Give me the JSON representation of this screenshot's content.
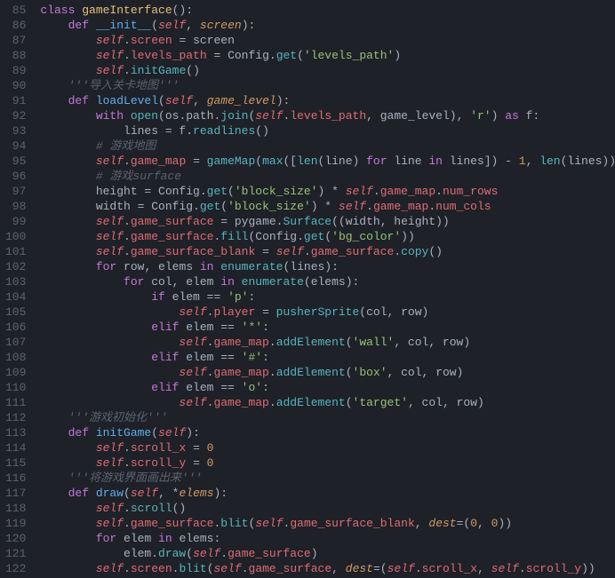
{
  "line_start": 85,
  "line_end": 122,
  "lines": {
    "85": [
      [
        "kw",
        "class "
      ],
      [
        "cls",
        "gameInterface"
      ],
      [
        "punc",
        "():"
      ]
    ],
    "86": [
      [
        "kw",
        "    def "
      ],
      [
        "def",
        "__init__"
      ],
      [
        "punc",
        "("
      ],
      [
        "self",
        "self"
      ],
      [
        "punc",
        ", "
      ],
      [
        "param",
        "screen"
      ],
      [
        "punc",
        "):"
      ]
    ],
    "87": [
      [
        "self",
        "        self"
      ],
      [
        "punc",
        "."
      ],
      [
        "prop",
        "screen"
      ],
      [
        "op",
        " = "
      ],
      [
        "op",
        "screen"
      ]
    ],
    "88": [
      [
        "self",
        "        self"
      ],
      [
        "punc",
        "."
      ],
      [
        "prop",
        "levels_path"
      ],
      [
        "op",
        " = "
      ],
      [
        "op",
        "Config."
      ],
      [
        "fn",
        "get"
      ],
      [
        "punc",
        "("
      ],
      [
        "str",
        "'levels_path'"
      ],
      [
        "punc",
        ")"
      ]
    ],
    "89": [
      [
        "self",
        "        self"
      ],
      [
        "punc",
        "."
      ],
      [
        "fn",
        "initGame"
      ],
      [
        "punc",
        "()"
      ]
    ],
    "90": [
      [
        "cmt",
        "    '''导入关卡地图'''"
      ]
    ],
    "91": [
      [
        "kw",
        "    def "
      ],
      [
        "def",
        "loadLevel"
      ],
      [
        "punc",
        "("
      ],
      [
        "self",
        "self"
      ],
      [
        "punc",
        ", "
      ],
      [
        "param",
        "game_level"
      ],
      [
        "punc",
        "):"
      ]
    ],
    "92": [
      [
        "kw",
        "        with "
      ],
      [
        "builtin",
        "open"
      ],
      [
        "punc",
        "(os.path."
      ],
      [
        "fn",
        "join"
      ],
      [
        "punc",
        "("
      ],
      [
        "self",
        "self"
      ],
      [
        "punc",
        "."
      ],
      [
        "prop",
        "levels_path"
      ],
      [
        "punc",
        ", game_level), "
      ],
      [
        "str",
        "'r'"
      ],
      [
        "punc",
        ") "
      ],
      [
        "kw",
        "as"
      ],
      [
        "punc",
        " f:"
      ]
    ],
    "93": [
      [
        "op",
        "            lines = f."
      ],
      [
        "fn",
        "readlines"
      ],
      [
        "punc",
        "()"
      ]
    ],
    "94": [
      [
        "cmt",
        "        # 游戏地图"
      ]
    ],
    "95": [
      [
        "self",
        "        self"
      ],
      [
        "punc",
        "."
      ],
      [
        "prop",
        "game_map"
      ],
      [
        "op",
        " = "
      ],
      [
        "fn",
        "gameMap"
      ],
      [
        "punc",
        "("
      ],
      [
        "builtin",
        "max"
      ],
      [
        "punc",
        "(["
      ],
      [
        "builtin",
        "len"
      ],
      [
        "punc",
        "(line) "
      ],
      [
        "kw",
        "for"
      ],
      [
        "punc",
        " line "
      ],
      [
        "kw",
        "in"
      ],
      [
        "punc",
        " lines]) - "
      ],
      [
        "num",
        "1"
      ],
      [
        "punc",
        ", "
      ],
      [
        "builtin",
        "len"
      ],
      [
        "punc",
        "(lines))"
      ]
    ],
    "96": [
      [
        "cmt",
        "        # 游戏surface"
      ]
    ],
    "97": [
      [
        "op",
        "        height = Config."
      ],
      [
        "fn",
        "get"
      ],
      [
        "punc",
        "("
      ],
      [
        "str",
        "'block_size'"
      ],
      [
        "punc",
        ") * "
      ],
      [
        "self",
        "self"
      ],
      [
        "punc",
        "."
      ],
      [
        "prop",
        "game_map"
      ],
      [
        "punc",
        "."
      ],
      [
        "prop",
        "num_rows"
      ]
    ],
    "98": [
      [
        "op",
        "        width = Config."
      ],
      [
        "fn",
        "get"
      ],
      [
        "punc",
        "("
      ],
      [
        "str",
        "'block_size'"
      ],
      [
        "punc",
        ") * "
      ],
      [
        "self",
        "self"
      ],
      [
        "punc",
        "."
      ],
      [
        "prop",
        "game_map"
      ],
      [
        "punc",
        "."
      ],
      [
        "prop",
        "num_cols"
      ]
    ],
    "99": [
      [
        "self",
        "        self"
      ],
      [
        "punc",
        "."
      ],
      [
        "prop",
        "game_surface"
      ],
      [
        "op",
        " = pygame."
      ],
      [
        "fn",
        "Surface"
      ],
      [
        "punc",
        "((width, height))"
      ]
    ],
    "100": [
      [
        "self",
        "        self"
      ],
      [
        "punc",
        "."
      ],
      [
        "prop",
        "game_surface"
      ],
      [
        "punc",
        "."
      ],
      [
        "fn",
        "fill"
      ],
      [
        "punc",
        "(Config."
      ],
      [
        "fn",
        "get"
      ],
      [
        "punc",
        "("
      ],
      [
        "str",
        "'bg_color'"
      ],
      [
        "punc",
        "))"
      ]
    ],
    "101": [
      [
        "self",
        "        self"
      ],
      [
        "punc",
        "."
      ],
      [
        "prop",
        "game_surface_blank"
      ],
      [
        "op",
        " = "
      ],
      [
        "self",
        "self"
      ],
      [
        "punc",
        "."
      ],
      [
        "prop",
        "game_surface"
      ],
      [
        "punc",
        "."
      ],
      [
        "fn",
        "copy"
      ],
      [
        "punc",
        "()"
      ]
    ],
    "102": [
      [
        "kw",
        "        for"
      ],
      [
        "op",
        " row, elems "
      ],
      [
        "kw",
        "in "
      ],
      [
        "builtin",
        "enumerate"
      ],
      [
        "punc",
        "(lines):"
      ]
    ],
    "103": [
      [
        "kw",
        "            for"
      ],
      [
        "op",
        " col, elem "
      ],
      [
        "kw",
        "in "
      ],
      [
        "builtin",
        "enumerate"
      ],
      [
        "punc",
        "(elems):"
      ]
    ],
    "104": [
      [
        "kw",
        "                if"
      ],
      [
        "op",
        " elem == "
      ],
      [
        "str",
        "'p'"
      ],
      [
        "punc",
        ":"
      ]
    ],
    "105": [
      [
        "self",
        "                    self"
      ],
      [
        "punc",
        "."
      ],
      [
        "prop",
        "player"
      ],
      [
        "op",
        " = "
      ],
      [
        "fn",
        "pusherSprite"
      ],
      [
        "punc",
        "(col, row)"
      ]
    ],
    "106": [
      [
        "kw",
        "                elif"
      ],
      [
        "op",
        " elem == "
      ],
      [
        "str",
        "'*'"
      ],
      [
        "punc",
        ":"
      ]
    ],
    "107": [
      [
        "self",
        "                    self"
      ],
      [
        "punc",
        "."
      ],
      [
        "prop",
        "game_map"
      ],
      [
        "punc",
        "."
      ],
      [
        "fn",
        "addElement"
      ],
      [
        "punc",
        "("
      ],
      [
        "str",
        "'wall'"
      ],
      [
        "punc",
        ", col, row)"
      ]
    ],
    "108": [
      [
        "kw",
        "                elif"
      ],
      [
        "op",
        " elem == "
      ],
      [
        "str",
        "'#'"
      ],
      [
        "punc",
        ":"
      ]
    ],
    "109": [
      [
        "self",
        "                    self"
      ],
      [
        "punc",
        "."
      ],
      [
        "prop",
        "game_map"
      ],
      [
        "punc",
        "."
      ],
      [
        "fn",
        "addElement"
      ],
      [
        "punc",
        "("
      ],
      [
        "str",
        "'box'"
      ],
      [
        "punc",
        ", col, row)"
      ]
    ],
    "110": [
      [
        "kw",
        "                elif"
      ],
      [
        "op",
        " elem == "
      ],
      [
        "str",
        "'o'"
      ],
      [
        "punc",
        ":"
      ]
    ],
    "111": [
      [
        "self",
        "                    self"
      ],
      [
        "punc",
        "."
      ],
      [
        "prop",
        "game_map"
      ],
      [
        "punc",
        "."
      ],
      [
        "fn",
        "addElement"
      ],
      [
        "punc",
        "("
      ],
      [
        "str",
        "'target'"
      ],
      [
        "punc",
        ", col, row)"
      ]
    ],
    "112": [
      [
        "cmt",
        "    '''游戏初始化'''"
      ]
    ],
    "113": [
      [
        "kw",
        "    def "
      ],
      [
        "def",
        "initGame"
      ],
      [
        "punc",
        "("
      ],
      [
        "self",
        "self"
      ],
      [
        "punc",
        "):"
      ]
    ],
    "114": [
      [
        "self",
        "        self"
      ],
      [
        "punc",
        "."
      ],
      [
        "prop",
        "scroll_x"
      ],
      [
        "op",
        " = "
      ],
      [
        "num",
        "0"
      ]
    ],
    "115": [
      [
        "self",
        "        self"
      ],
      [
        "punc",
        "."
      ],
      [
        "prop",
        "scroll_y"
      ],
      [
        "op",
        " = "
      ],
      [
        "num",
        "0"
      ]
    ],
    "116": [
      [
        "cmt",
        "    '''将游戏界面画出来'''"
      ]
    ],
    "117": [
      [
        "kw",
        "    def "
      ],
      [
        "def",
        "draw"
      ],
      [
        "punc",
        "("
      ],
      [
        "self",
        "self"
      ],
      [
        "punc",
        ", *"
      ],
      [
        "param",
        "elems"
      ],
      [
        "punc",
        "):"
      ]
    ],
    "118": [
      [
        "self",
        "        self"
      ],
      [
        "punc",
        "."
      ],
      [
        "fn",
        "scroll"
      ],
      [
        "punc",
        "()"
      ]
    ],
    "119": [
      [
        "self",
        "        self"
      ],
      [
        "punc",
        "."
      ],
      [
        "prop",
        "game_surface"
      ],
      [
        "punc",
        "."
      ],
      [
        "fn",
        "blit"
      ],
      [
        "punc",
        "("
      ],
      [
        "self",
        "self"
      ],
      [
        "punc",
        "."
      ],
      [
        "prop",
        "game_surface_blank"
      ],
      [
        "punc",
        ", "
      ],
      [
        "param",
        "dest"
      ],
      [
        "op",
        "="
      ],
      [
        "punc",
        "("
      ],
      [
        "num",
        "0"
      ],
      [
        "punc",
        ", "
      ],
      [
        "num",
        "0"
      ],
      [
        "punc",
        "))"
      ]
    ],
    "120": [
      [
        "kw",
        "        for"
      ],
      [
        "op",
        " elem "
      ],
      [
        "kw",
        "in"
      ],
      [
        "op",
        " elems:"
      ]
    ],
    "121": [
      [
        "op",
        "            elem."
      ],
      [
        "fn",
        "draw"
      ],
      [
        "punc",
        "("
      ],
      [
        "self",
        "self"
      ],
      [
        "punc",
        "."
      ],
      [
        "prop",
        "game_surface"
      ],
      [
        "punc",
        ")"
      ]
    ],
    "122": [
      [
        "self",
        "        self"
      ],
      [
        "punc",
        "."
      ],
      [
        "prop",
        "screen"
      ],
      [
        "punc",
        "."
      ],
      [
        "fn",
        "blit"
      ],
      [
        "punc",
        "("
      ],
      [
        "self",
        "self"
      ],
      [
        "punc",
        "."
      ],
      [
        "prop",
        "game_surface"
      ],
      [
        "punc",
        ", "
      ],
      [
        "param",
        "dest"
      ],
      [
        "op",
        "="
      ],
      [
        "punc",
        "("
      ],
      [
        "self",
        "self"
      ],
      [
        "punc",
        "."
      ],
      [
        "prop",
        "scroll_x"
      ],
      [
        "punc",
        ", "
      ],
      [
        "self",
        "self"
      ],
      [
        "punc",
        "."
      ],
      [
        "prop",
        "scroll_y"
      ],
      [
        "punc",
        "))"
      ]
    ]
  }
}
